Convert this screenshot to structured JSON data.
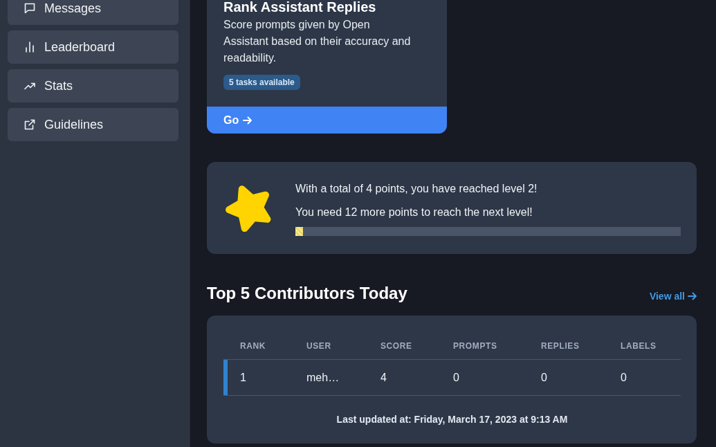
{
  "sidebar": {
    "items": [
      {
        "label": "Messages",
        "selected": false
      },
      {
        "label": "Leaderboard",
        "selected": false
      },
      {
        "label": "Stats",
        "selected": false
      },
      {
        "label": "Guidelines",
        "selected": false
      }
    ]
  },
  "task_card": {
    "title": "Rank Assistant Replies",
    "description": "Score prompts given by Open Assistant based on their accuracy and readability.",
    "badge": "5 tasks available",
    "action": "Go"
  },
  "level_card": {
    "lines": [
      "With a total of 4 points, you have reached level 2!",
      "You need 12 more points to reach the next level!"
    ],
    "progress": {
      "level": 0.02
    }
  },
  "leaderboard": {
    "title": "Top 5 Contributors Today",
    "view_all": "View all",
    "table": {
      "columns": [
        "RANK",
        "USER",
        "SCORE",
        "PROMPTS",
        "REPLIES",
        "LABELS"
      ],
      "rows": [
        {
          "cells": [
            "1",
            "meh…",
            "4",
            "0",
            "0",
            "0"
          ],
          "highlighted": true
        }
      ]
    },
    "last_updated": "Last updated at: Friday, March 17, 2023 at 9:13 AM"
  }
}
